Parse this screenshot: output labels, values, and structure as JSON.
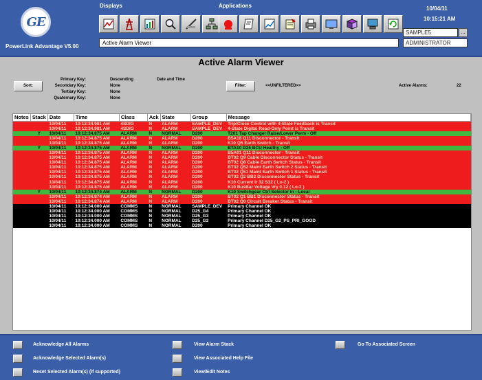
{
  "header": {
    "logo_text": "GE",
    "app_name": "PowerLink Advantage V5.00",
    "displays_label": "Displays",
    "applications_label": "Applications",
    "view_title": "Active Alarm Viewer",
    "date": "10/04/11",
    "time": "10:15:21 AM",
    "server": "SAMPLE5",
    "server_browse": "...",
    "user": "ADMINISTRATOR",
    "display_icons": [
      "trend-icon",
      "tower-icon",
      "chart-icon",
      "magnifier-icon",
      "ruler-icon",
      "network-icon"
    ],
    "app_icons": [
      "alarm-bell-icon",
      "notepad-icon",
      "graph-icon",
      "report-icon",
      "printer-icon",
      "terminal-icon",
      "book-icon",
      "monitor-icon",
      "refresh-icon"
    ]
  },
  "page_title": "Active Alarm Viewer",
  "sort": {
    "button": "Sort:",
    "primary_label": "Primary Key:",
    "secondary_label": "Secondary Key:",
    "tertiary_label": "Tertiary Key:",
    "quaternary_label": "Quaternary Key:",
    "primary_dir": "Descending",
    "primary_field": "Date and Time",
    "secondary_value": "None",
    "tertiary_value": "None",
    "quaternary_value": "None"
  },
  "filter": {
    "button": "Filter:",
    "value": "<<UNFILTERED>>",
    "active_label": "Active Alarms:",
    "active_count": "22"
  },
  "table": {
    "columns": [
      "Notes",
      "Stack",
      "Date",
      "Time",
      "Class",
      "Ack",
      "State",
      "Group",
      "Message"
    ],
    "rows": [
      {
        "t": "alarm",
        "notes": "",
        "stack": "",
        "date": "10/04/11",
        "time": "10:12:34.981 AM",
        "cls": "4SDIG",
        "ack": "N",
        "state": "ALARM",
        "group": "SAMPLE_DEV",
        "msg": "Trip/Close Control with 4-State Feedback is Transit"
      },
      {
        "t": "alarm",
        "notes": "",
        "stack": "",
        "date": "10/04/11",
        "time": "10:12:34.981 AM",
        "cls": "4SDIG",
        "ack": "N",
        "state": "ALARM",
        "group": "SAMPLE_DEV",
        "msg": "4-State Digital Read-Only Point is Transit"
      },
      {
        "t": "normal",
        "notes": "",
        "stack": "Y",
        "date": "10/04/11",
        "time": "10:12:34.875 AM",
        "cls": "ALARM",
        "ack": "N",
        "state": "NORMAL",
        "group": "D200",
        "msg": "T201 Tap Changer Raise/Lower Perm - Off"
      },
      {
        "t": "alarm",
        "notes": "",
        "stack": "",
        "date": "10/04/11",
        "time": "10:12:34.875 AM",
        "cls": "ALARM",
        "ack": "N",
        "state": "ALARM",
        "group": "D200",
        "msg": "B5A18 Q11 Disconnector - Transit"
      },
      {
        "t": "alarm",
        "notes": "",
        "stack": "",
        "date": "10/04/11",
        "time": "10:12:34.875 AM",
        "cls": "ALARM",
        "ack": "N",
        "state": "ALARM",
        "group": "D200",
        "msg": "K10 Q5 Earth Switch - Transit"
      },
      {
        "t": "normal",
        "notes": "",
        "stack": "Y",
        "date": "10/04/11",
        "time": "10:12:34.875 AM",
        "cls": "ALARM",
        "ack": "N",
        "state": "NORMAL",
        "group": "D200",
        "msg": "BTA10 D25 BCU Healthy - Off"
      },
      {
        "t": "alarm",
        "notes": "",
        "stack": "",
        "date": "10/04/11",
        "time": "10:12:34.875 AM",
        "cls": "ALARM",
        "ack": "N",
        "state": "ALARM",
        "group": "D200",
        "msg": "B5A01 Q11 Disconnector - Transit"
      },
      {
        "t": "alarm",
        "notes": "",
        "stack": "",
        "date": "10/04/11",
        "time": "10:12:34.875 AM",
        "cls": "ALARM",
        "ack": "N",
        "state": "ALARM",
        "group": "D200",
        "msg": "BT02 Q9 Cable Disconnector Status - Transit"
      },
      {
        "t": "alarm",
        "notes": "",
        "stack": "",
        "date": "10/04/11",
        "time": "10:12:34.875 AM",
        "cls": "ALARM",
        "ack": "N",
        "state": "ALARM",
        "group": "D200",
        "msg": "BT02 Q8 Cable Earth Switch Status - Transit"
      },
      {
        "t": "alarm",
        "notes": "",
        "stack": "",
        "date": "10/04/11",
        "time": "10:12:34.875 AM",
        "cls": "ALARM",
        "ack": "N",
        "state": "ALARM",
        "group": "D200",
        "msg": "BT02 Q52 Maint Earth Switch 2 Status - Transit"
      },
      {
        "t": "alarm",
        "notes": "",
        "stack": "",
        "date": "10/04/11",
        "time": "10:12:34.875 AM",
        "cls": "ALARM",
        "ack": "N",
        "state": "ALARM",
        "group": "D200",
        "msg": "BT02 Q51 Maint Earth Switch 1 Status - Transit"
      },
      {
        "t": "alarm",
        "notes": "",
        "stack": "",
        "date": "10/04/11",
        "time": "10:12:34.875 AM",
        "cls": "ALARM",
        "ack": "N",
        "state": "ALARM",
        "group": "D200",
        "msg": "BT02 Q2 BB2 Disconnector Status - Transit"
      },
      {
        "t": "alarm",
        "notes": "",
        "stack": "",
        "date": "10/04/11",
        "time": "10:12:34.875 AM",
        "cls": "ALARM",
        "ack": "N",
        "state": "ALARM",
        "group": "D200",
        "msg": "K10 Current Ir 32 S32 ( Lo-2 )"
      },
      {
        "t": "alarm",
        "notes": "",
        "stack": "",
        "date": "10/04/11",
        "time": "10:12:34.875 AM",
        "cls": "ALARM",
        "ack": "N",
        "state": "ALARM",
        "group": "D200",
        "msg": "K10 BusBar Voltage Vry 0.12 ( Lo-2 )"
      },
      {
        "t": "normal",
        "notes": "",
        "stack": "Y",
        "date": "10/04/11",
        "time": "10:12:34.874 AM",
        "cls": "ALARM",
        "ack": "N",
        "state": "NORMAL",
        "group": "D200",
        "msg": "K10 Switchgear Ctrl Selector in - Local"
      },
      {
        "t": "alarm",
        "notes": "",
        "stack": "",
        "date": "10/04/11",
        "time": "10:12:34.874 AM",
        "cls": "ALARM",
        "ack": "N",
        "state": "ALARM",
        "group": "D200",
        "msg": "BT02 Q1 BB1 Disconnector Status - Transit"
      },
      {
        "t": "alarm",
        "notes": "",
        "stack": "",
        "date": "10/04/11",
        "time": "10:12:34.874 AM",
        "cls": "ALARM",
        "ack": "N",
        "state": "ALARM",
        "group": "D200",
        "msg": "BT02 Q0 Circuit Breaker Status - Transit"
      },
      {
        "t": "comms",
        "notes": "",
        "stack": "",
        "date": "10/04/11",
        "time": "10:12:34.000 AM",
        "cls": "COMMS",
        "ack": "N",
        "state": "NORMAL",
        "group": "SAMPLE_DEV",
        "msg": "Primary Channel OK"
      },
      {
        "t": "comms",
        "notes": "",
        "stack": "",
        "date": "10/04/11",
        "time": "10:12:34.000 AM",
        "cls": "COMMS",
        "ack": "N",
        "state": "NORMAL",
        "group": "D25_G4",
        "msg": "Primary Channel OK"
      },
      {
        "t": "comms",
        "notes": "",
        "stack": "",
        "date": "10/04/11",
        "time": "10:12:34.000 AM",
        "cls": "COMMS",
        "ack": "N",
        "state": "NORMAL",
        "group": "D25_G3",
        "msg": "Primary Channel OK"
      },
      {
        "t": "comms",
        "notes": "",
        "stack": "",
        "date": "10/04/11",
        "time": "10:12:34.000 AM",
        "cls": "COMMS",
        "ack": "N",
        "state": "NORMAL",
        "group": "D25_G2",
        "msg": "Primary Channel D25_G2_PS_PRI_GOOD"
      },
      {
        "t": "comms",
        "notes": "",
        "stack": "",
        "date": "10/04/11",
        "time": "10:12:34.000 AM",
        "cls": "COMMS",
        "ack": "N",
        "state": "NORMAL",
        "group": "D200",
        "msg": "Primary Channel OK"
      }
    ]
  },
  "actions": {
    "ack_all": "Acknowledge All Alarms",
    "ack_selected": "Acknowledge Selected Alarm(s)",
    "reset_selected": "Reset Selected Alarm(s) (if supported)",
    "view_stack": "View Alarm Stack",
    "view_help": "View Associated Help File",
    "view_notes": "View/Edit Notes",
    "goto_screen": "Go To Associated Screen"
  },
  "colors": {
    "header_blue": "#3a5fa8",
    "alarm_red": "#ee1c1c",
    "normal_green": "#3fb83f",
    "comms_black": "#000000"
  }
}
